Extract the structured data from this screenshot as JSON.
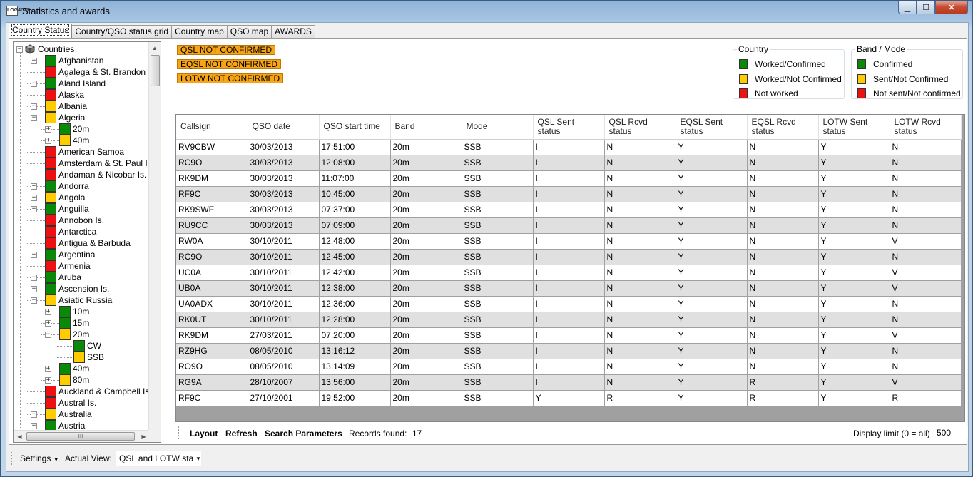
{
  "window": {
    "title": "Statistics and awards",
    "app_icon_text": "LOG4OM",
    "buttons": {
      "minimize": "▁",
      "maximize": "☐",
      "close": "✕"
    }
  },
  "tabs": [
    "Country Status",
    "Country/QSO status grid",
    "Country map",
    "QSO map",
    "AWARDS"
  ],
  "tree": {
    "root": "Countries",
    "nodes": [
      {
        "label": "Afghanistan",
        "color": "green",
        "level": 1,
        "expander": "+"
      },
      {
        "label": "Agalega & St. Brandon Is.",
        "color": "red",
        "level": 1,
        "expander": ""
      },
      {
        "label": "Aland Island",
        "color": "green",
        "level": 1,
        "expander": "+"
      },
      {
        "label": "Alaska",
        "color": "red",
        "level": 1,
        "expander": ""
      },
      {
        "label": "Albania",
        "color": "yellow",
        "level": 1,
        "expander": "+"
      },
      {
        "label": "Algeria",
        "color": "yellow",
        "level": 1,
        "expander": "−"
      },
      {
        "label": "20m",
        "color": "green",
        "level": 2,
        "expander": "+"
      },
      {
        "label": "40m",
        "color": "yellow",
        "level": 2,
        "expander": "+"
      },
      {
        "label": "American Samoa",
        "color": "red",
        "level": 1,
        "expander": ""
      },
      {
        "label": "Amsterdam & St. Paul Is.",
        "color": "red",
        "level": 1,
        "expander": ""
      },
      {
        "label": "Andaman & Nicobar Is.",
        "color": "red",
        "level": 1,
        "expander": ""
      },
      {
        "label": "Andorra",
        "color": "green",
        "level": 1,
        "expander": "+"
      },
      {
        "label": "Angola",
        "color": "yellow",
        "level": 1,
        "expander": "+"
      },
      {
        "label": "Anguilla",
        "color": "green",
        "level": 1,
        "expander": "+"
      },
      {
        "label": "Annobon Is.",
        "color": "red",
        "level": 1,
        "expander": ""
      },
      {
        "label": "Antarctica",
        "color": "red",
        "level": 1,
        "expander": ""
      },
      {
        "label": "Antigua & Barbuda",
        "color": "red",
        "level": 1,
        "expander": ""
      },
      {
        "label": "Argentina",
        "color": "green",
        "level": 1,
        "expander": "+"
      },
      {
        "label": "Armenia",
        "color": "red",
        "level": 1,
        "expander": ""
      },
      {
        "label": "Aruba",
        "color": "green",
        "level": 1,
        "expander": "+"
      },
      {
        "label": "Ascension Is.",
        "color": "green",
        "level": 1,
        "expander": "+"
      },
      {
        "label": "Asiatic Russia",
        "color": "yellow",
        "level": 1,
        "expander": "−"
      },
      {
        "label": "10m",
        "color": "green",
        "level": 2,
        "expander": "+"
      },
      {
        "label": "15m",
        "color": "green",
        "level": 2,
        "expander": "+"
      },
      {
        "label": "20m",
        "color": "yellow",
        "level": 2,
        "expander": "−"
      },
      {
        "label": "CW",
        "color": "green",
        "level": 3,
        "expander": ""
      },
      {
        "label": "SSB",
        "color": "yellow",
        "level": 3,
        "expander": ""
      },
      {
        "label": "40m",
        "color": "green",
        "level": 2,
        "expander": "+"
      },
      {
        "label": "80m",
        "color": "yellow",
        "level": 2,
        "expander": "+"
      },
      {
        "label": "Auckland & Campbell Is.",
        "color": "red",
        "level": 1,
        "expander": ""
      },
      {
        "label": "Austral Is.",
        "color": "red",
        "level": 1,
        "expander": ""
      },
      {
        "label": "Australia",
        "color": "yellow",
        "level": 1,
        "expander": "+"
      },
      {
        "label": "Austria",
        "color": "green",
        "level": 1,
        "expander": "+"
      }
    ],
    "scroll_thumb_label": "III"
  },
  "filters": [
    "QSL NOT CONFIRMED",
    "EQSL NOT CONFIRMED",
    "LOTW NOT CONFIRMED"
  ],
  "legend_country": {
    "title": "Country",
    "items": [
      {
        "label": "Worked/Confirmed",
        "color": "green"
      },
      {
        "label": "Worked/Not Confirmed",
        "color": "yellow"
      },
      {
        "label": "Not worked",
        "color": "red"
      }
    ]
  },
  "legend_band": {
    "title": "Band / Mode",
    "items": [
      {
        "label": "Confirmed",
        "color": "green"
      },
      {
        "label": "Sent/Not Confirmed",
        "color": "yellow"
      },
      {
        "label": "Not sent/Not confirmed",
        "color": "red"
      }
    ]
  },
  "colors": {
    "green": "#088a08",
    "yellow": "#ffcc00",
    "red": "#ee1111",
    "filter_orange": "#f7a516"
  },
  "grid": {
    "columns": [
      [
        "Callsign",
        ""
      ],
      [
        "QSO date",
        ""
      ],
      [
        "QSO start time",
        ""
      ],
      [
        "Band",
        ""
      ],
      [
        "Mode",
        ""
      ],
      [
        "QSL Sent",
        "status"
      ],
      [
        "QSL Rcvd",
        "status"
      ],
      [
        "EQSL Sent",
        "status"
      ],
      [
        "EQSL Rcvd",
        "status"
      ],
      [
        "LOTW Sent",
        "status"
      ],
      [
        "LOTW Rcvd",
        "status"
      ]
    ],
    "rows": [
      [
        "RV9CBW",
        "30/03/2013",
        "17:51:00",
        "20m",
        "SSB",
        "I",
        "N",
        "Y",
        "N",
        "Y",
        "N"
      ],
      [
        "RC9O",
        "30/03/2013",
        "12:08:00",
        "20m",
        "SSB",
        "I",
        "N",
        "Y",
        "N",
        "Y",
        "N"
      ],
      [
        "RK9DM",
        "30/03/2013",
        "11:07:00",
        "20m",
        "SSB",
        "I",
        "N",
        "Y",
        "N",
        "Y",
        "N"
      ],
      [
        "RF9C",
        "30/03/2013",
        "10:45:00",
        "20m",
        "SSB",
        "I",
        "N",
        "Y",
        "N",
        "Y",
        "N"
      ],
      [
        "RK9SWF",
        "30/03/2013",
        "07:37:00",
        "20m",
        "SSB",
        "I",
        "N",
        "Y",
        "N",
        "Y",
        "N"
      ],
      [
        "RU9CC",
        "30/03/2013",
        "07:09:00",
        "20m",
        "SSB",
        "I",
        "N",
        "Y",
        "N",
        "Y",
        "N"
      ],
      [
        "RW0A",
        "30/10/2011",
        "12:48:00",
        "20m",
        "SSB",
        "I",
        "N",
        "Y",
        "N",
        "Y",
        "V"
      ],
      [
        "RC9O",
        "30/10/2011",
        "12:45:00",
        "20m",
        "SSB",
        "I",
        "N",
        "Y",
        "N",
        "Y",
        "N"
      ],
      [
        "UC0A",
        "30/10/2011",
        "12:42:00",
        "20m",
        "SSB",
        "I",
        "N",
        "Y",
        "N",
        "Y",
        "V"
      ],
      [
        "UB0A",
        "30/10/2011",
        "12:38:00",
        "20m",
        "SSB",
        "I",
        "N",
        "Y",
        "N",
        "Y",
        "V"
      ],
      [
        "UA0ADX",
        "30/10/2011",
        "12:36:00",
        "20m",
        "SSB",
        "I",
        "N",
        "Y",
        "N",
        "Y",
        "N"
      ],
      [
        "RK0UT",
        "30/10/2011",
        "12:28:00",
        "20m",
        "SSB",
        "I",
        "N",
        "Y",
        "N",
        "Y",
        "N"
      ],
      [
        "RK9DM",
        "27/03/2011",
        "07:20:00",
        "20m",
        "SSB",
        "I",
        "N",
        "Y",
        "N",
        "Y",
        "V"
      ],
      [
        "RZ9HG",
        "08/05/2010",
        "13:16:12",
        "20m",
        "SSB",
        "I",
        "N",
        "Y",
        "N",
        "Y",
        "N"
      ],
      [
        "RO9O",
        "08/05/2010",
        "13:14:09",
        "20m",
        "SSB",
        "I",
        "N",
        "Y",
        "N",
        "Y",
        "N"
      ],
      [
        "RG9A",
        "28/10/2007",
        "13:56:00",
        "20m",
        "SSB",
        "I",
        "N",
        "Y",
        "R",
        "Y",
        "V"
      ],
      [
        "RF9C",
        "27/10/2001",
        "19:52:00",
        "20m",
        "SSB",
        "Y",
        "R",
        "Y",
        "R",
        "Y",
        "R"
      ]
    ]
  },
  "grid_toolbar": {
    "layout": "Layout",
    "refresh": "Refresh",
    "search": "Search Parameters",
    "records_label": "Records found:",
    "records_count": "17",
    "display_limit_label": "Display limit (0 = all)",
    "display_limit_value": "500"
  },
  "bottom_toolbar": {
    "settings": "Settings",
    "actual_view_label": "Actual View:",
    "actual_view_value": "QSL and LOTW sta"
  }
}
